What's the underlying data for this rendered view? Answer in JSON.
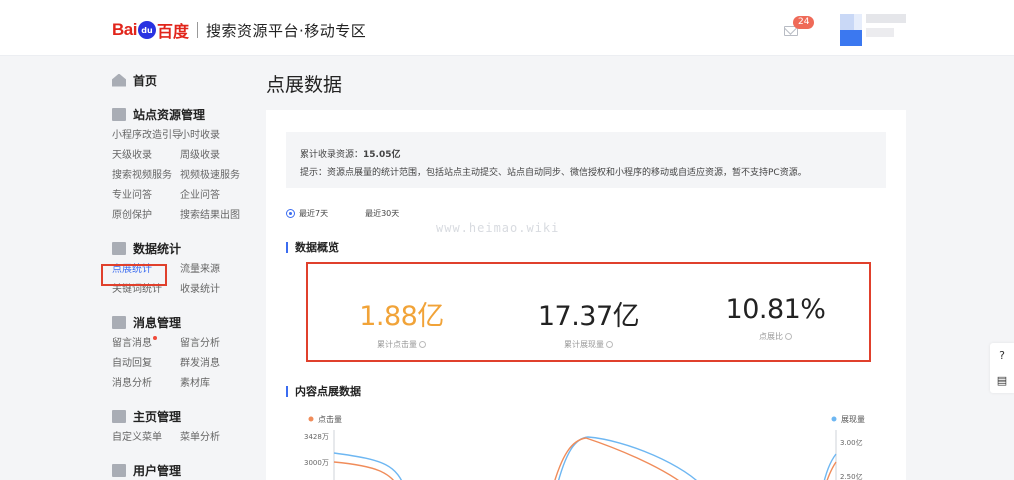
{
  "header": {
    "logo_bai": "Bai",
    "logo_du": "du",
    "logo_cn": "百度",
    "title": "搜索资源平台·移动专区",
    "mail_badge": "24"
  },
  "sidebar": {
    "home": "首页",
    "sections": [
      {
        "title": "站点资源管理",
        "items": [
          "小程序改造引导",
          "小时收录",
          "天级收录",
          "周级收录",
          "搜索视频服务",
          "视频极速服务",
          "专业问答",
          "企业问答",
          "原创保护",
          "搜索结果出图"
        ]
      },
      {
        "title": "数据统计",
        "items": [
          "点展统计",
          "流量来源",
          "关键词统计",
          "收录统计"
        ]
      },
      {
        "title": "消息管理",
        "items": [
          "留言消息",
          "留言分析",
          "自动回复",
          "群发消息",
          "消息分析",
          "素材库"
        ]
      },
      {
        "title": "主页管理",
        "items": [
          "自定义菜单",
          "菜单分析"
        ]
      },
      {
        "title": "用户管理",
        "items": []
      }
    ]
  },
  "main": {
    "page_title": "点展数据",
    "notice_label": "累计收录资源：",
    "notice_value": "15.05亿",
    "notice_tip": "提示：资源点展量的统计范围，包括站点主动提交、站点自动同步、微信授权和小程序的移动或自适应资源，暂不支持PC资源。",
    "range_options": [
      "最近7天",
      "最近30天"
    ],
    "selected_range": "最近7天",
    "watermark": "www.heimao.wiki",
    "overview_title": "数据概览",
    "stats": [
      {
        "value": "1.88亿",
        "label": "累计点击量"
      },
      {
        "value": "17.37亿",
        "label": "累计展现量"
      },
      {
        "value": "10.81%",
        "label": "点展比"
      }
    ],
    "content_title": "内容点展数据",
    "right_float": [
      "?",
      "▤"
    ]
  },
  "chart_data": {
    "type": "line",
    "series": [
      {
        "name": "点击量",
        "color": "#f08c5a"
      },
      {
        "name": "展现量",
        "color": "#6eb7f2"
      }
    ],
    "y_left_ticks": [
      "3428万",
      "3000万"
    ],
    "y_right_ticks": [
      "3.00亿",
      "2.50亿"
    ]
  },
  "colors": {
    "accent": "#3b6cf0",
    "highlight": "#e0402c",
    "orange": "#f1a338"
  }
}
